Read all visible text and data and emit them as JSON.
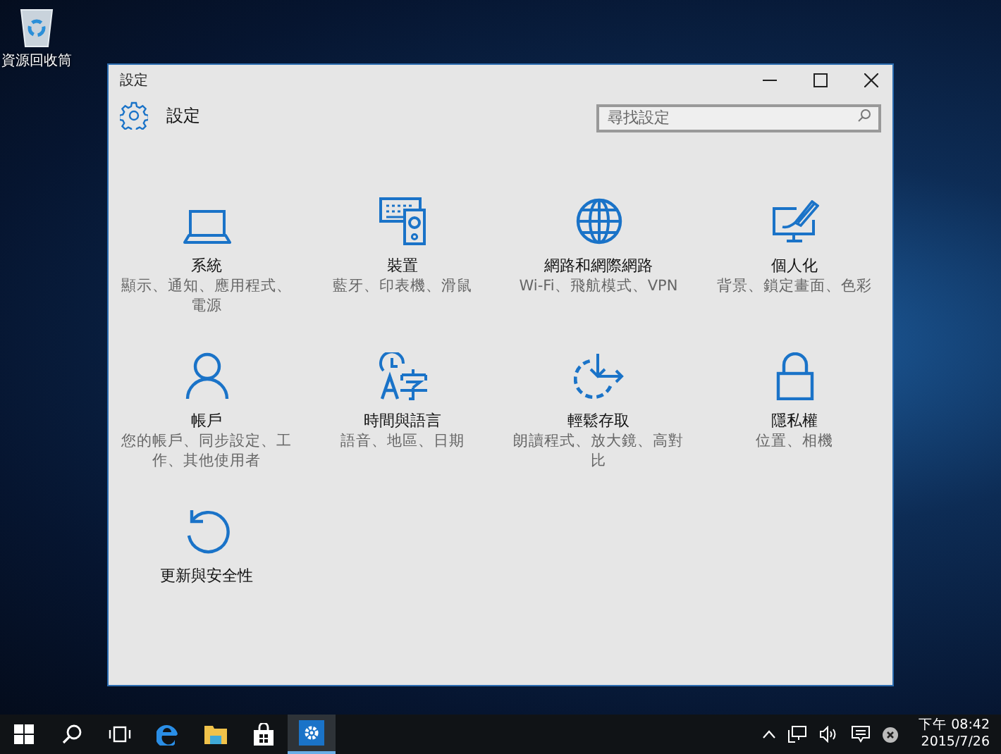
{
  "desktop": {
    "icons": [
      {
        "label": "資源回收筒",
        "kind": "recycle-bin"
      }
    ]
  },
  "window": {
    "title": "設定",
    "header": "設定",
    "search": {
      "placeholder": "尋找設定"
    },
    "categories": [
      {
        "kind": "laptop",
        "title": "系統",
        "description": "顯示、通知、應用程式、電源"
      },
      {
        "kind": "devices",
        "title": "裝置",
        "description": "藍牙、印表機、滑鼠"
      },
      {
        "kind": "globe",
        "title": "網路和網際網路",
        "description": "Wi-Fi、飛航模式、VPN"
      },
      {
        "kind": "brush",
        "title": "個人化",
        "description": "背景、鎖定畫面、色彩"
      },
      {
        "kind": "person",
        "title": "帳戶",
        "description": "您的帳戶、同步設定、工作、其他使用者"
      },
      {
        "kind": "time-language",
        "title": "時間與語言",
        "description": "語音、地區、日期"
      },
      {
        "kind": "ease",
        "title": "輕鬆存取",
        "description": "朗讀程式、放大鏡、高對比"
      },
      {
        "kind": "lock",
        "title": "隱私權",
        "description": "位置、相機"
      },
      {
        "kind": "update",
        "title": "更新與安全性"
      }
    ]
  },
  "taskbar": {
    "items": [
      {
        "kind": "start",
        "selected": false
      },
      {
        "kind": "search",
        "selected": false
      },
      {
        "kind": "task-view",
        "selected": false
      },
      {
        "kind": "edge",
        "selected": false
      },
      {
        "kind": "explorer",
        "selected": false
      },
      {
        "kind": "store",
        "selected": false
      },
      {
        "kind": "settings",
        "selected": true
      }
    ],
    "clock": {
      "time": "下午 08:42",
      "date": "2015/7/26"
    }
  }
}
